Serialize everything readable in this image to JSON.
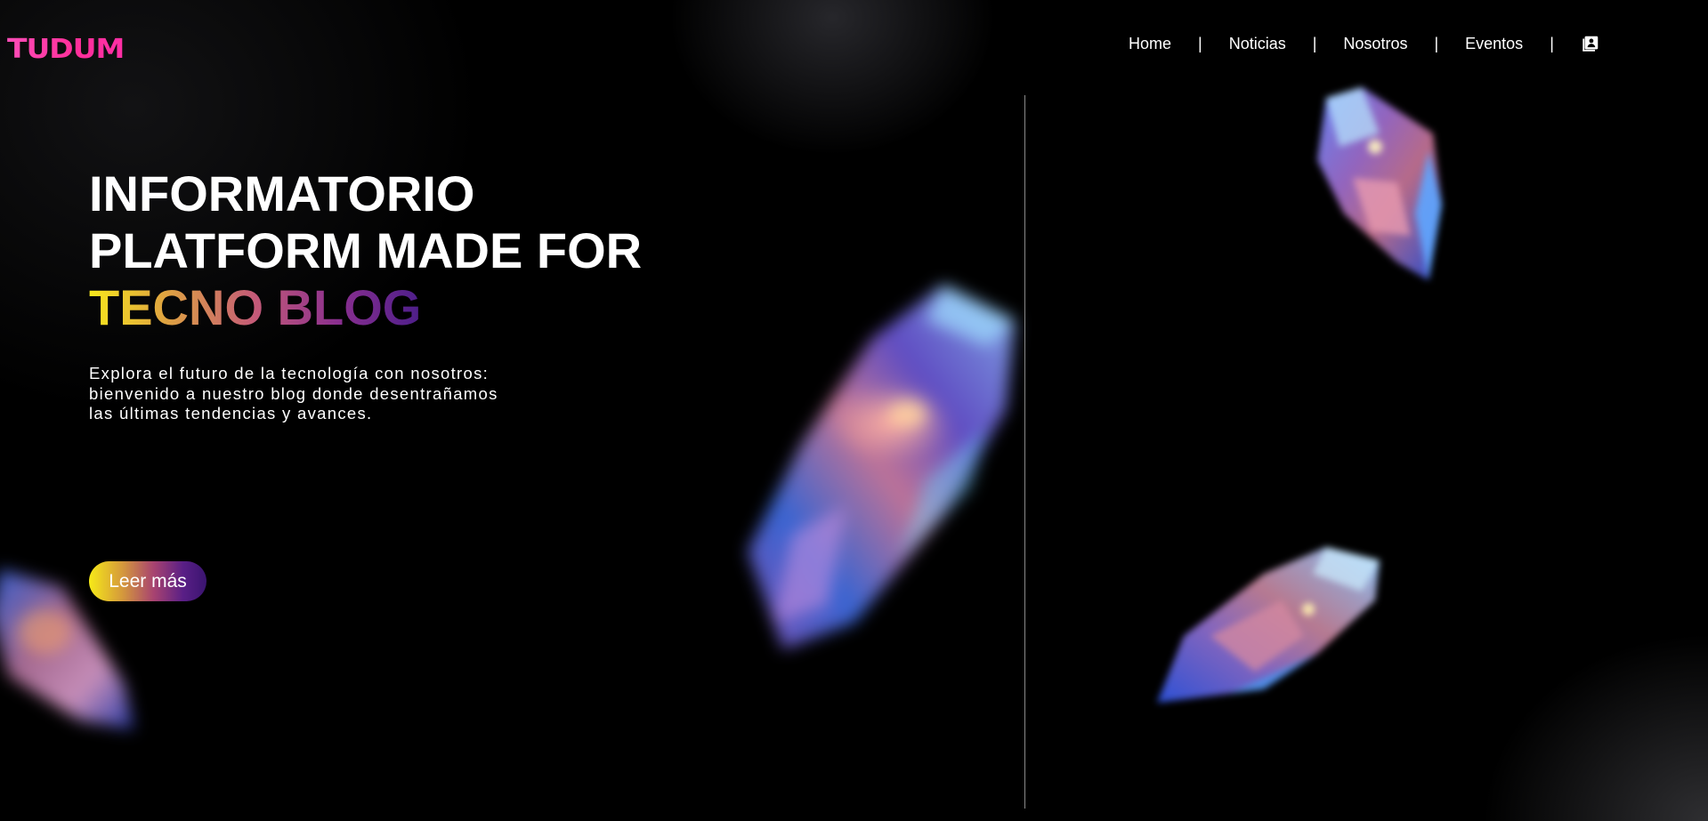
{
  "header": {
    "logo": "TUDUM",
    "nav": [
      {
        "label": "Home"
      },
      {
        "label": "Noticias"
      },
      {
        "label": "Nosotros"
      },
      {
        "label": "Eventos"
      }
    ],
    "separator": "|",
    "profile_icon": "contacts-book-icon"
  },
  "hero": {
    "title_line1": "INFORMATORIO",
    "title_line2": "PLATFORM MADE FOR",
    "title_line3": "TECNO BLOG",
    "description_line1": "Explora el futuro de la tecnología con nosotros:",
    "description_line2": "bienvenido a nuestro blog donde desentrañamos",
    "description_line3": "las últimas tendencias y avances.",
    "cta_label": "Leer más"
  },
  "colors": {
    "background": "#000000",
    "logo": "#ff3fa8",
    "gradient_start": "#f8e81c",
    "gradient_end": "#4d1e8a"
  }
}
